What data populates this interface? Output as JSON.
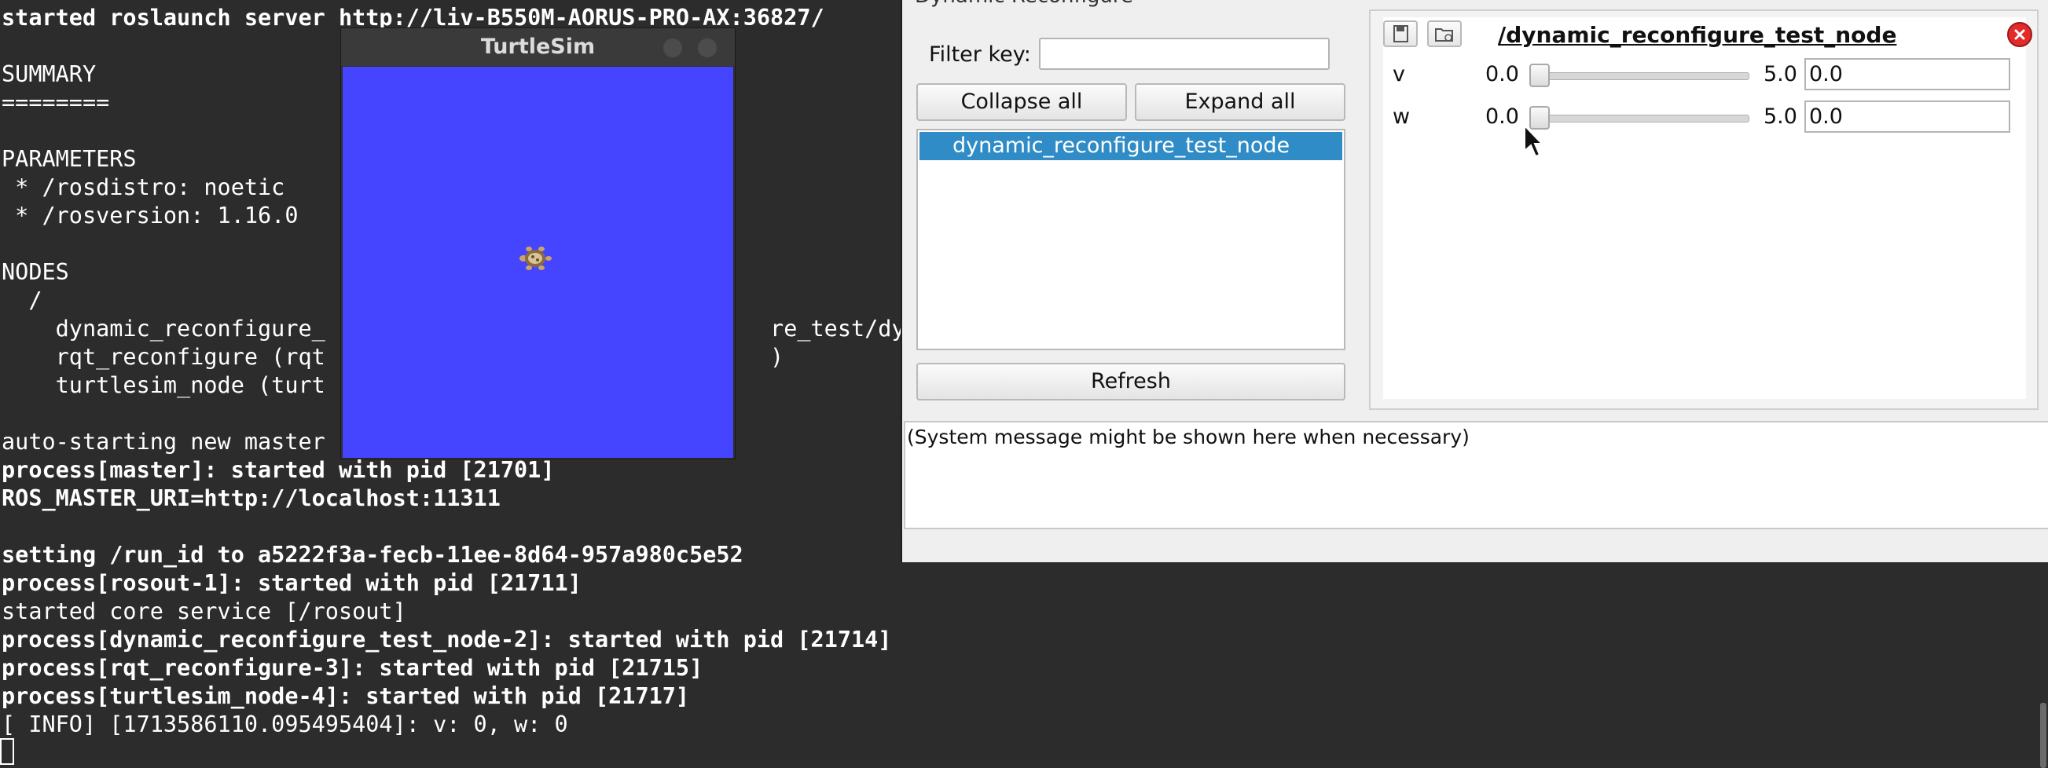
{
  "terminal": {
    "lines": [
      {
        "text": "started roslaunch server http://liv-B550M-AORUS-PRO-AX:36827/",
        "bold": true
      },
      {
        "text": "",
        "bold": false
      },
      {
        "text": "SUMMARY",
        "bold": false
      },
      {
        "text": "========",
        "bold": false
      },
      {
        "text": "",
        "bold": false
      },
      {
        "text": "PARAMETERS",
        "bold": false
      },
      {
        "text": " * /rosdistro: noetic",
        "bold": false
      },
      {
        "text": " * /rosversion: 1.16.0",
        "bold": false
      },
      {
        "text": "",
        "bold": false
      },
      {
        "text": "NODES",
        "bold": false
      },
      {
        "text": "  /",
        "bold": false
      },
      {
        "text": "    dynamic_reconfigure_                                 re_test/dyna",
        "bold": false
      },
      {
        "text": "    rqt_reconfigure (rqt                                 )",
        "bold": false
      },
      {
        "text": "    turtlesim_node (turt",
        "bold": false
      },
      {
        "text": "",
        "bold": false
      },
      {
        "text": "auto-starting new master",
        "bold": false
      },
      {
        "text": "process[master]: started with pid [21701]",
        "bold": true
      },
      {
        "text": "ROS_MASTER_URI=http://localhost:11311",
        "bold": true
      },
      {
        "text": "",
        "bold": false
      },
      {
        "text": "setting /run_id to a5222f3a-fecb-11ee-8d64-957a980c5e52",
        "bold": true
      },
      {
        "text": "process[rosout-1]: started with pid [21711]",
        "bold": true
      },
      {
        "text": "started core service [/rosout]",
        "bold": false
      },
      {
        "text": "process[dynamic_reconfigure_test_node-2]: started with pid [21714]",
        "bold": true
      },
      {
        "text": "process[rqt_reconfigure-3]: started with pid [21715]",
        "bold": true
      },
      {
        "text": "process[turtlesim_node-4]: started with pid [21717]",
        "bold": true
      },
      {
        "text": "[ INFO] [1713586110.095495404]: v: 0, w: 0",
        "bold": false
      }
    ]
  },
  "turtlesim": {
    "title": "TurtleSim",
    "background_color": "#4545ff"
  },
  "dynamic_reconfigure": {
    "window_title": "Dynamic Reconfigure",
    "filter_label": "Filter key:",
    "filter_value": "",
    "collapse_label": "Collapse all",
    "expand_label": "Expand all",
    "nodes": [
      "dynamic_reconfigure_test_node"
    ],
    "refresh_label": "Refresh",
    "node_panel_title": "/dynamic_reconfigure_test_node",
    "params": [
      {
        "name": "v",
        "min": "0.0",
        "max": "5.0",
        "value": "0.0",
        "slider_fraction": 0
      },
      {
        "name": "w",
        "min": "0.0",
        "max": "5.0",
        "value": "0.0",
        "slider_fraction": 0
      }
    ],
    "system_message": "(System message might be shown here when necessary)",
    "selection_color": "#308cc6",
    "close_color": "#e22b2b"
  }
}
